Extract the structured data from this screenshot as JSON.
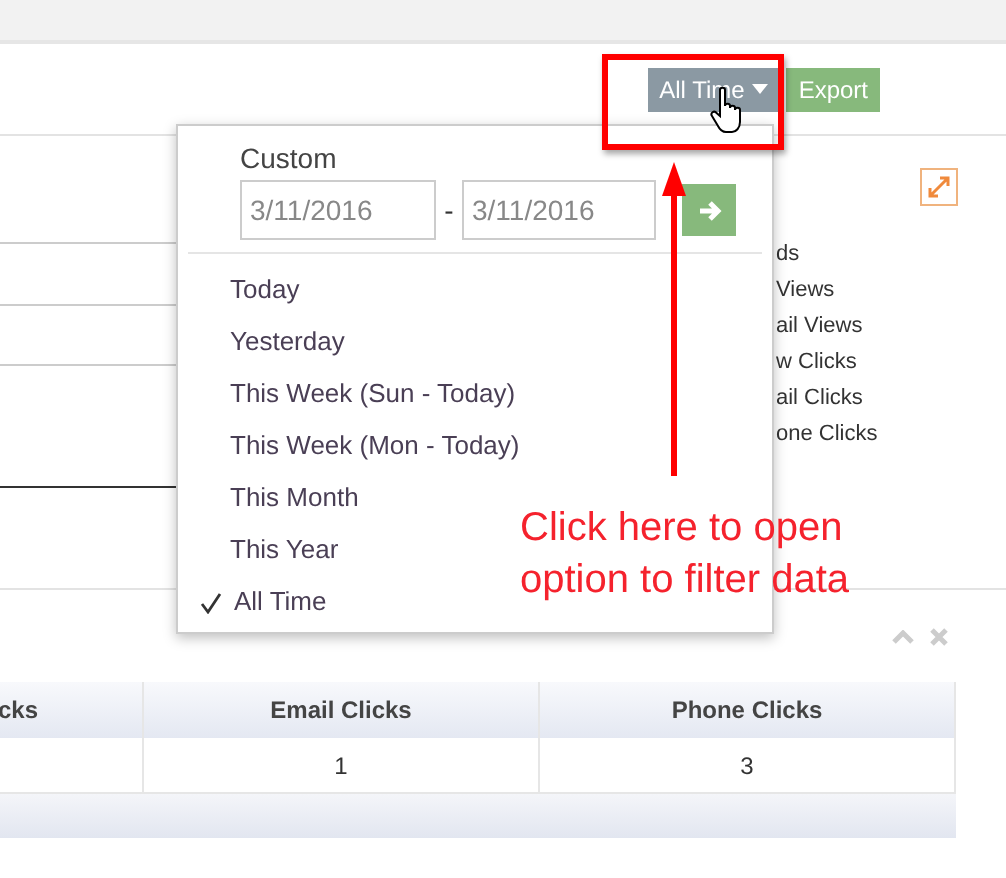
{
  "toolbar": {
    "buttons": [
      {
        "label": "All Time",
        "kind": "dropdown"
      },
      {
        "label": "Export",
        "kind": "plain"
      }
    ]
  },
  "chart_legend": [
    "ds",
    "Views",
    "ail Views",
    "w Clicks",
    "ail Clicks",
    "one Clicks"
  ],
  "date_menu": {
    "custom_label": "Custom",
    "from": "3/11/2016",
    "separator": "-",
    "to": "3/11/2016",
    "items": [
      {
        "label": "Today",
        "selected": false
      },
      {
        "label": "Yesterday",
        "selected": false
      },
      {
        "label": "This Week (Sun - Today)",
        "selected": false
      },
      {
        "label": "This Week (Mon - Today)",
        "selected": false
      },
      {
        "label": "This Month",
        "selected": false
      },
      {
        "label": "This Year",
        "selected": false
      },
      {
        "label": "All Time",
        "selected": true
      }
    ]
  },
  "annotation": "Click here to open option to filter data",
  "table": {
    "columns": [
      "cks",
      "Email Clicks",
      "Phone Clicks"
    ],
    "rows": [
      {
        "cells": [
          "",
          "1",
          "3"
        ]
      }
    ]
  }
}
